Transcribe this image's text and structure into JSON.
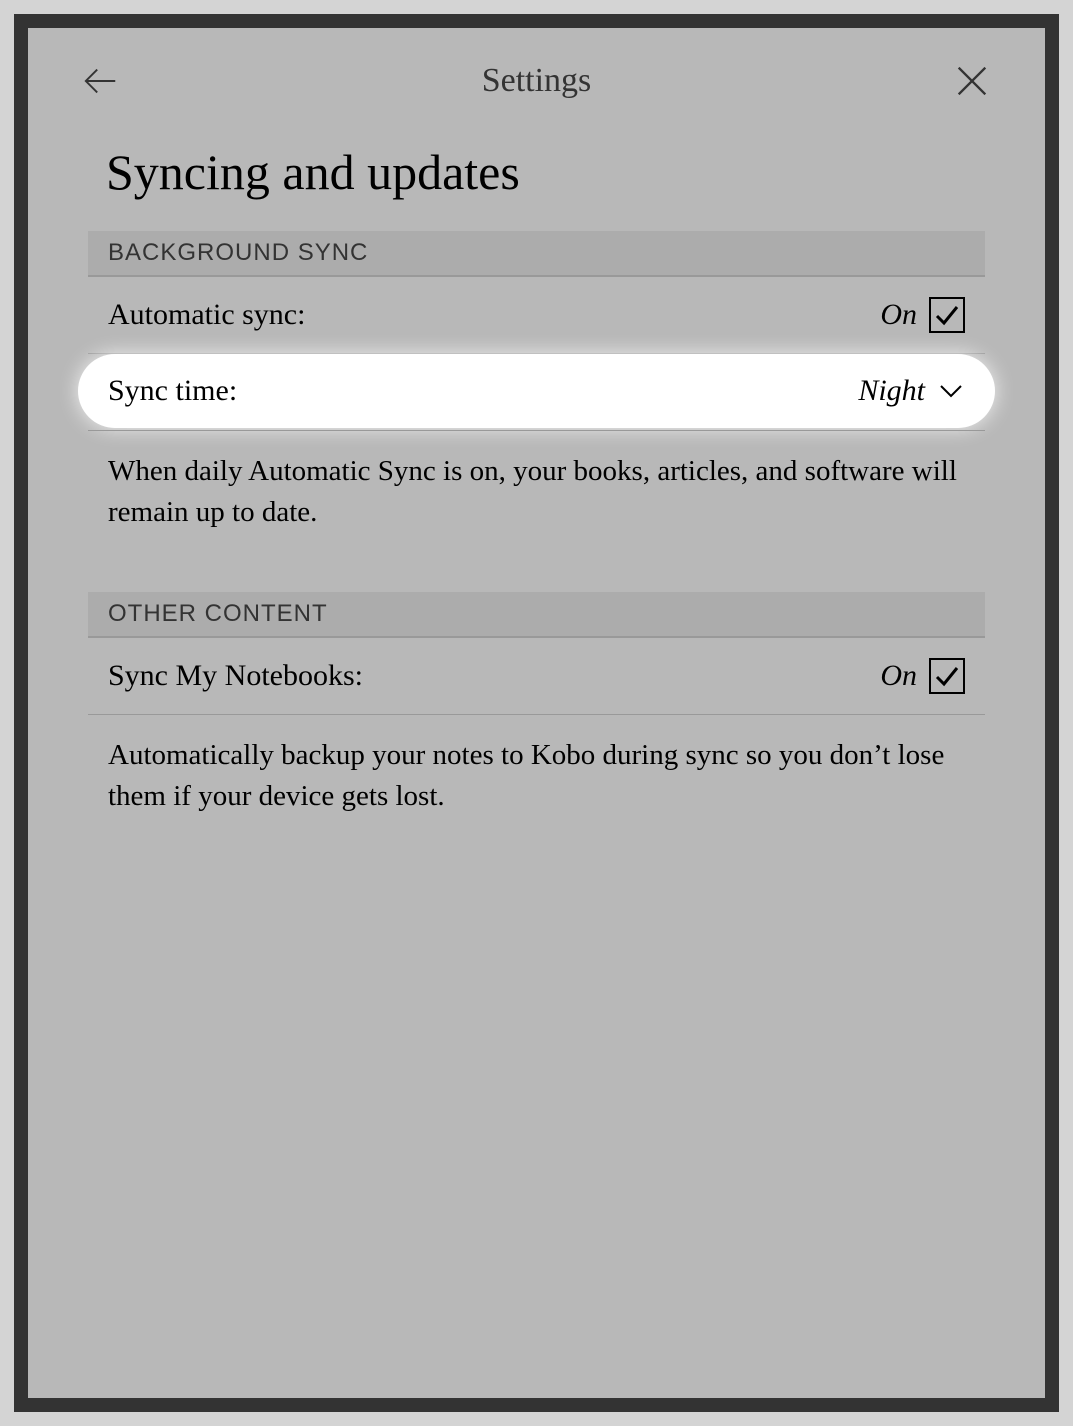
{
  "header": {
    "title": "Settings"
  },
  "page": {
    "title": "Syncing and updates"
  },
  "sections": {
    "background_sync": {
      "header": "BACKGROUND SYNC",
      "automatic_sync": {
        "label": "Automatic sync:",
        "value": "On"
      },
      "sync_time": {
        "label": "Sync time:",
        "value": "Night"
      },
      "description": "When daily Automatic Sync is on, your books, articles, and software will remain up to date."
    },
    "other_content": {
      "header": "OTHER CONTENT",
      "sync_notebooks": {
        "label": "Sync My Notebooks:",
        "value": "On"
      },
      "description": "Automatically backup your notes to Kobo during sync so you don’t lose them if your device gets lost."
    }
  }
}
